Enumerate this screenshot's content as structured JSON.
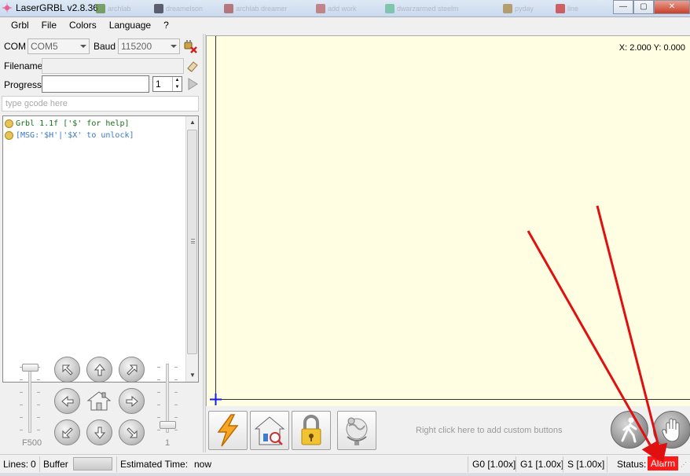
{
  "window": {
    "title": "LaserGRBL v2.8.36",
    "icon": "laser-icon",
    "background_tasks": [
      "archlab",
      "dreamelson",
      "archlab dreamer",
      "add work",
      "dwarzarmed steelm",
      "pyday",
      "line"
    ],
    "controls": {
      "minimize": "—",
      "maximize": "▢",
      "close": "✕"
    }
  },
  "menu": [
    "Grbl",
    "File",
    "Colors",
    "Language",
    "?"
  ],
  "connection": {
    "com_label": "COM",
    "com_value": "COM5",
    "baud_label": "Baud",
    "baud_value": "115200",
    "connect_icon": "disconnect-plug-icon"
  },
  "file": {
    "filename_label": "Filename",
    "filename_value": "",
    "clear_icon": "eraser-icon"
  },
  "progress": {
    "label": "Progress",
    "fraction": 0,
    "passes_value": "1",
    "run_icon": "play-icon"
  },
  "gcode_input": {
    "placeholder": "type gcode here"
  },
  "console": {
    "lines": [
      {
        "text": "Grbl 1.1f ['$' for help]",
        "color": "#1a6e1a"
      },
      {
        "text": "[MSG:'$H'|'$X' to unlock]",
        "color": "#3a78c6"
      }
    ]
  },
  "jog": {
    "speed_label": "F500",
    "step_label": "1",
    "buttons": [
      "jog-up-left",
      "jog-up",
      "jog-up-right",
      "jog-left",
      "jog-home",
      "jog-right",
      "jog-down-left",
      "jog-down",
      "jog-down-right"
    ]
  },
  "canvas": {
    "coords": "X: 2.000 Y: 0.000",
    "background": "#fffde2"
  },
  "toolbar": {
    "custom_hint": "Right click here to add custom buttons",
    "buttons": [
      "reset-lightning-icon",
      "homing-house-icon",
      "unlock-padlock-icon",
      "globe-pin-icon"
    ],
    "right_buttons": [
      "walk-icon",
      "stop-hand-icon"
    ]
  },
  "statusbar": {
    "lines_label": "Lines:",
    "lines_value": "0",
    "buffer_label": "Buffer",
    "estimated_label": "Estimated Time:",
    "estimated_value": "now",
    "g0": "G0 [1.00x]",
    "g1": "G1 [1.00x]",
    "s": "S [1.00x]",
    "status_label": "Status:",
    "status_value": "Alarm",
    "status_color": "#ff1a1a"
  },
  "annotation": {
    "arrow_color": "#e01010"
  }
}
